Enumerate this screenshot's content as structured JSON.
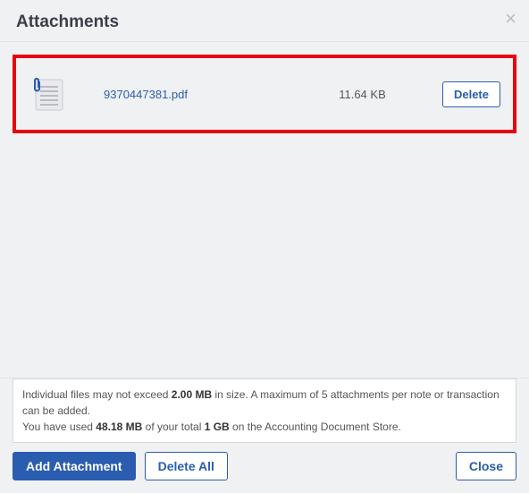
{
  "modal": {
    "title": "Attachments"
  },
  "attachments": [
    {
      "filename": "9370447381.pdf",
      "size": "11.64 KB",
      "delete_label": "Delete"
    }
  ],
  "info": {
    "line1_prefix": "Individual files may not exceed ",
    "max_file_size": "2.00 MB",
    "line1_mid": " in size. A maximum of ",
    "max_attachments": "5",
    "line1_suffix": " attachments per note or transaction can be added.",
    "line2_prefix": "You have used ",
    "used_storage": "48.18 MB",
    "line2_mid": " of your total ",
    "total_storage": "1 GB",
    "line2_suffix": " on the Accounting Document Store."
  },
  "buttons": {
    "add_attachment": "Add Attachment",
    "delete_all": "Delete All",
    "close": "Close"
  }
}
